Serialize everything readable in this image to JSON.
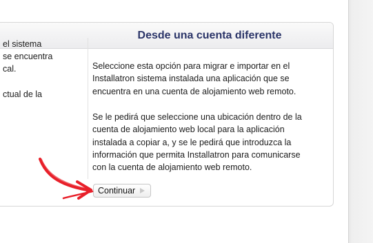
{
  "panel": {
    "title": "Desde una cuenta diferente"
  },
  "left_column": {
    "lines": [
      "el sistema",
      "se encuentra",
      "cal.",
      "ctual de la"
    ]
  },
  "right_column": {
    "paragraph1": [
      "Seleccione esta opción para migrar e importar en el",
      "Installatron sistema instalada una aplicación que se",
      "encuentra en una cuenta de alojamiento web remoto."
    ],
    "paragraph2": [
      "Se le pedirá que seleccione una ubicación dentro de la",
      "cuenta de alojamiento web local para la aplicación",
      "instalada a copiar a, y se le pedirá que introduzca la",
      "información que permita Installatron para comunicarse",
      "con la cuenta de alojamiento web remoto."
    ]
  },
  "button": {
    "label": "Continuar",
    "icon": "play-icon"
  },
  "annotation": {
    "icon": "red-arrow-icon",
    "color": "#e8202a"
  },
  "colors": {
    "title": "#2a3468",
    "border": "#d6d6d6",
    "arrow": "#e8202a"
  }
}
